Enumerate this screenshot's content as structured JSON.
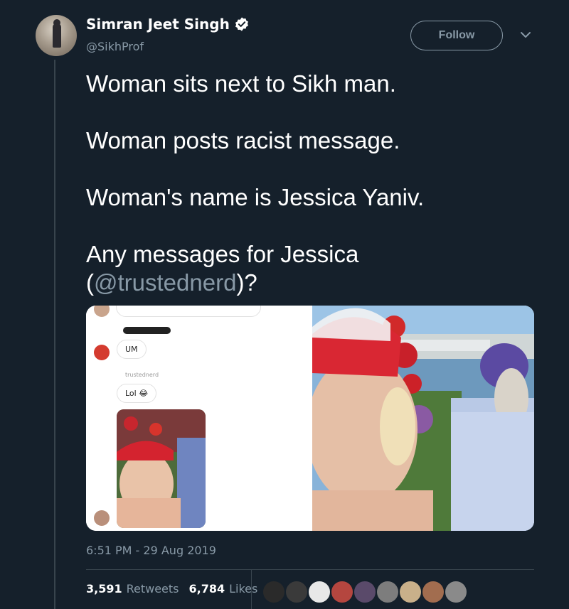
{
  "author": {
    "display_name": "Simran Jeet Singh",
    "handle": "@SikhProf",
    "verified": true
  },
  "header": {
    "follow_label": "Follow"
  },
  "tweet": {
    "line1": "Woman sits next to Sikh man.",
    "line2": "Woman posts racist message.",
    "line3": "Woman's name is Jessica Yaniv.",
    "line4_prefix": "Any messages for Jessica",
    "line4_open": "(",
    "mention": "@trustednerd",
    "line4_close": ")?"
  },
  "media": {
    "left_panel": {
      "message_um": "UM",
      "sender_label": "trustednerd",
      "message_lol": "Lol 😂"
    }
  },
  "meta": {
    "timestamp": "6:51 PM - 29 Aug 2019",
    "retweets_count": "3,591",
    "retweets_label": "Retweets",
    "likes_count": "6,784",
    "likes_label": "Likes"
  },
  "colors": {
    "background": "#15202b",
    "muted": "#8899a6",
    "border": "#38444d"
  }
}
